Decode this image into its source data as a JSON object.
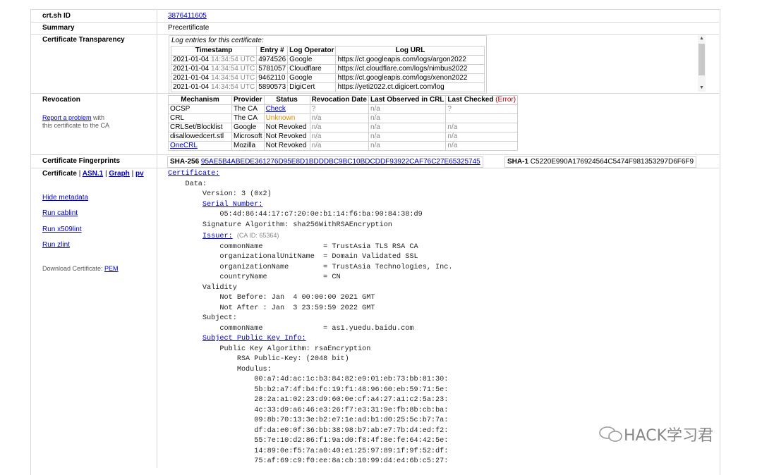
{
  "rows": {
    "crtsh_id_label": "crt.sh ID",
    "crtsh_id_value": "3876411605",
    "summary_label": "Summary",
    "summary_value": "Precertificate",
    "ct_label": "Certificate Transparency",
    "revocation_label": "Revocation",
    "fingerprints_label": "Certificate Fingerprints",
    "certificate_label": "Certificate"
  },
  "ct_log": {
    "caption": "Log entries for this certificate:",
    "headers": [
      "Timestamp",
      "Entry #",
      "Log Operator",
      "Log URL"
    ],
    "rows": [
      {
        "date": "2021-01-04",
        "time": "14:34:54 UTC",
        "entry": "4974526",
        "operator": "Google",
        "url": "https://ct.googleapis.com/logs/argon2022"
      },
      {
        "date": "2021-01-04",
        "time": "14:34:54 UTC",
        "entry": "5781057",
        "operator": "Cloudflare",
        "url": "https://ct.cloudflare.com/logs/nimbus2022"
      },
      {
        "date": "2021-01-04",
        "time": "14:34:54 UTC",
        "entry": "9462110",
        "operator": "Google",
        "url": "https://ct.googleapis.com/logs/xenon2022"
      },
      {
        "date": "2021-01-04",
        "time": "14:34:54 UTC",
        "entry": "5890573",
        "operator": "DigiCert",
        "url": "https://yeti2022.ct.digicert.com/log"
      }
    ]
  },
  "revocation": {
    "report_link": "Report a problem",
    "report_text1": " with",
    "report_text2": "this certificate to the CA",
    "headers": [
      "Mechanism",
      "Provider",
      "Status",
      "Revocation Date",
      "Last Observed in CRL",
      "Last Checked"
    ],
    "error_label": "(Error)",
    "rows": [
      {
        "mechanism": "OCSP",
        "provider": "The CA",
        "status": "Check",
        "rev_date": "?",
        "last_observed": "n/a",
        "last_checked": "?"
      },
      {
        "mechanism": "CRL",
        "provider": "The CA",
        "status": "Unknown",
        "rev_date": "n/a",
        "last_observed": "n/a",
        "last_checked": ""
      },
      {
        "mechanism": "CRLSet/Blocklist",
        "provider": "Google",
        "status": "Not Revoked",
        "rev_date": "n/a",
        "last_observed": "n/a",
        "last_checked": "n/a"
      },
      {
        "mechanism": "disallowedcert.stl",
        "provider": "Microsoft",
        "status": "Not Revoked",
        "rev_date": "n/a",
        "last_observed": "n/a",
        "last_checked": "n/a"
      },
      {
        "mechanism": "OneCRL",
        "provider": "Mozilla",
        "status": "Not Revoked",
        "rev_date": "n/a",
        "last_observed": "n/a",
        "last_checked": "n/a"
      }
    ]
  },
  "fingerprints": {
    "sha256_label": "SHA-256",
    "sha256_value": "95AE5B4ABEDE361276D95E8D1BDDDBC9BC10BDCDDF93922CAF76C27E65325745",
    "sha1_label": "SHA-1",
    "sha1_value": "C5220E990A176924564C5474F981353297D6F6F9"
  },
  "certificate_links": {
    "asn1": "ASN.1",
    "graph": "Graph",
    "pv": "pv",
    "sep": "|"
  },
  "sidebar": {
    "hide_metadata": "Hide metadata",
    "run_cablint": "Run cablint",
    "run_x509lint": "Run x509lint",
    "run_zlint": "Run zlint",
    "download_text": "Download Certificate: ",
    "pem": "PEM"
  },
  "cert": {
    "certificate": "Certificate:",
    "data": "Data:",
    "version": "Version: 3 (0x2)",
    "serial_label": "Serial Number:",
    "serial": "05:4d:86:44:17:c7:20:0e:b1:14:f6:ba:90:84:38:d9",
    "sig_alg": "Signature Algorithm: sha256WithRSAEncryption",
    "issuer_label": "Issuer:",
    "issuer_ca_id": "(CA ID: 65364)",
    "issuer_cn": "commonName              = TrustAsia TLS RSA CA",
    "issuer_ou": "organizationalUnitName  = Domain Validated SSL",
    "issuer_o": "organizationName        = TrustAsia Technologies, Inc.",
    "issuer_c": "countryName             = CN",
    "validity": "Validity",
    "not_before": "Not Before: Jan  4 00:00:00 2021 GMT",
    "not_after": "Not After : Jan  3 23:59:59 2022 GMT",
    "subject": "Subject:",
    "subject_cn": "commonName              = as1.yuedu.baidu.com",
    "spki_label": "Subject Public Key Info:",
    "pk_alg": "Public Key Algorithm: rsaEncryption",
    "rsa_key": "RSA Public-Key: (2048 bit)",
    "modulus": "Modulus:",
    "mod1": "00:a7:4d:ac:1c:b3:84:82:e9:01:eb:73:bb:81:30:",
    "mod2": "5b:b2:a7:4f:b4:fc:19:f1:48:96:60:eb:59:71:5e:",
    "mod3": "28:2a:a1:02:23:d9:60:0e:cf:a4:27:a1:c2:5a:23:",
    "mod4": "4c:33:d9:a6:46:e3:26:f7:e3:31:9e:fb:8b:cb:ba:",
    "mod5": "09:8b:70:13:3e:b2:e7:1e:ad:b1:d0:25:5c:b7:7a:",
    "mod6": "df:da:e0:0f:36:bb:38:98:b7:ab:e7:7b:d4:ed:f2:",
    "mod7": "55:7e:10:d2:86:f1:9a:d0:f8:4f:8e:fe:64:42:5e:",
    "mod8": "14:89:0e:f5:7a:a0:40:e1:25:97:89:1f:9f:52:df:",
    "mod9": "75:af:69:c9:f0:ee:8a:cb:10:99:d4:e4:6b:c5:27:"
  },
  "watermark": "HACK学习君"
}
